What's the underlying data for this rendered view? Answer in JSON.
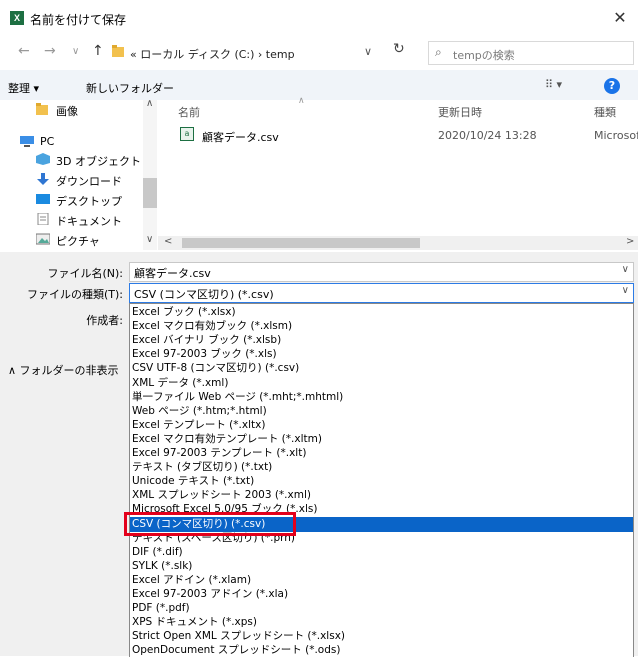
{
  "window": {
    "title": "名前を付けて保存",
    "app_icon": "X"
  },
  "address": {
    "path": "« ローカル ディスク (C:) › temp",
    "search_placeholder": "tempの検索"
  },
  "toolbar": {
    "organize": "整理 ▾",
    "new_folder": "新しいフォルダー",
    "view": "⠿ ▾",
    "help": "?"
  },
  "nav": {
    "items": [
      "画像",
      "PC",
      "3D オブジェクト",
      "ダウンロード",
      "デスクトップ",
      "ドキュメント",
      "ピクチャ"
    ]
  },
  "columns": {
    "name": "名前",
    "date": "更新日時",
    "type": "種類"
  },
  "file": {
    "name": "顧客データ.csv",
    "date": "2020/10/24 13:28",
    "type": "Microsoft E"
  },
  "form": {
    "filename_label": "ファイル名(N):",
    "filename_value": "顧客データ.csv",
    "filetype_label": "ファイルの種類(T):",
    "filetype_value": "CSV (コンマ区切り) (*.csv)",
    "author_label": "作成者:",
    "hide_folders": "∧ フォルダーの非表示"
  },
  "dropdown_options": [
    "Excel ブック (*.xlsx)",
    "Excel マクロ有効ブック (*.xlsm)",
    "Excel バイナリ ブック (*.xlsb)",
    "Excel 97-2003 ブック (*.xls)",
    "CSV UTF-8 (コンマ区切り) (*.csv)",
    "XML データ (*.xml)",
    "単一ファイル Web ページ (*.mht;*.mhtml)",
    "Web ページ (*.htm;*.html)",
    "Excel テンプレート (*.xltx)",
    "Excel マクロ有効テンプレート (*.xltm)",
    "Excel 97-2003 テンプレート (*.xlt)",
    "テキスト (タブ区切り) (*.txt)",
    "Unicode テキスト (*.txt)",
    "XML スプレッドシート 2003 (*.xml)",
    "Microsoft Excel 5.0/95 ブック (*.xls)",
    "CSV (コンマ区切り) (*.csv)",
    "テキスト (スペース区切り) (*.prn)",
    "DIF (*.dif)",
    "SYLK (*.slk)",
    "Excel アドイン (*.xlam)",
    "Excel 97-2003 アドイン (*.xla)",
    "PDF (*.pdf)",
    "XPS ドキュメント (*.xps)",
    "Strict Open XML スプレッドシート (*.xlsx)",
    "OpenDocument スプレッドシート (*.ods)"
  ],
  "selected_option": 15,
  "colors": {
    "selection": "#0a64c8",
    "highlight": "#e3001b",
    "excel_green": "#1d6f42"
  }
}
